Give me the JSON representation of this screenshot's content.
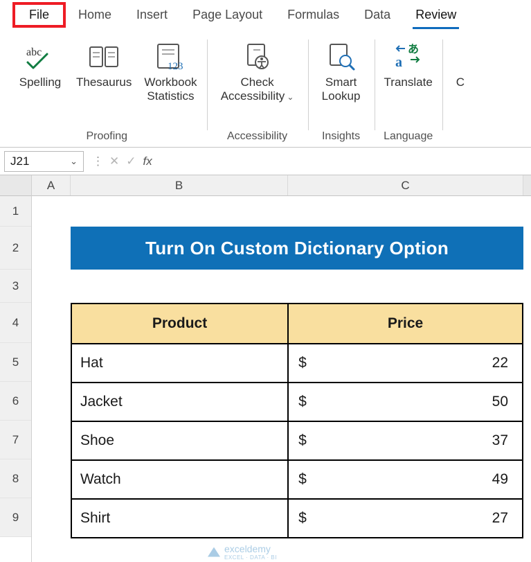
{
  "tabs": {
    "file": "File",
    "home": "Home",
    "insert": "Insert",
    "page_layout": "Page Layout",
    "formulas": "Formulas",
    "data": "Data",
    "review": "Review"
  },
  "ribbon": {
    "proofing": {
      "spelling": "Spelling",
      "thesaurus": "Thesaurus",
      "workbook_stats_l1": "Workbook",
      "workbook_stats_l2": "Statistics",
      "group_label": "Proofing"
    },
    "accessibility": {
      "check_l1": "Check",
      "check_l2": "Accessibility",
      "group_label": "Accessibility"
    },
    "insights": {
      "smart_l1": "Smart",
      "smart_l2": "Lookup",
      "group_label": "Insights"
    },
    "language": {
      "translate": "Translate",
      "group_label": "Language"
    }
  },
  "formula_bar": {
    "name_box": "J21",
    "fx": "fx",
    "value": ""
  },
  "columns": {
    "A": "A",
    "B": "B",
    "C": "C"
  },
  "rows": [
    "1",
    "2",
    "3",
    "4",
    "5",
    "6",
    "7",
    "8",
    "9"
  ],
  "banner_title": "Turn On Custom Dictionary Option",
  "table": {
    "headers": {
      "product": "Product",
      "price": "Price"
    },
    "currency": "$",
    "rows": [
      {
        "product": "Hat",
        "price": "22"
      },
      {
        "product": "Jacket",
        "price": "50"
      },
      {
        "product": "Shoe",
        "price": "37"
      },
      {
        "product": "Watch",
        "price": "49"
      },
      {
        "product": "Shirt",
        "price": "27"
      }
    ]
  },
  "watermark": {
    "brand": "exceldemy",
    "tag": "EXCEL · DATA · BI"
  }
}
